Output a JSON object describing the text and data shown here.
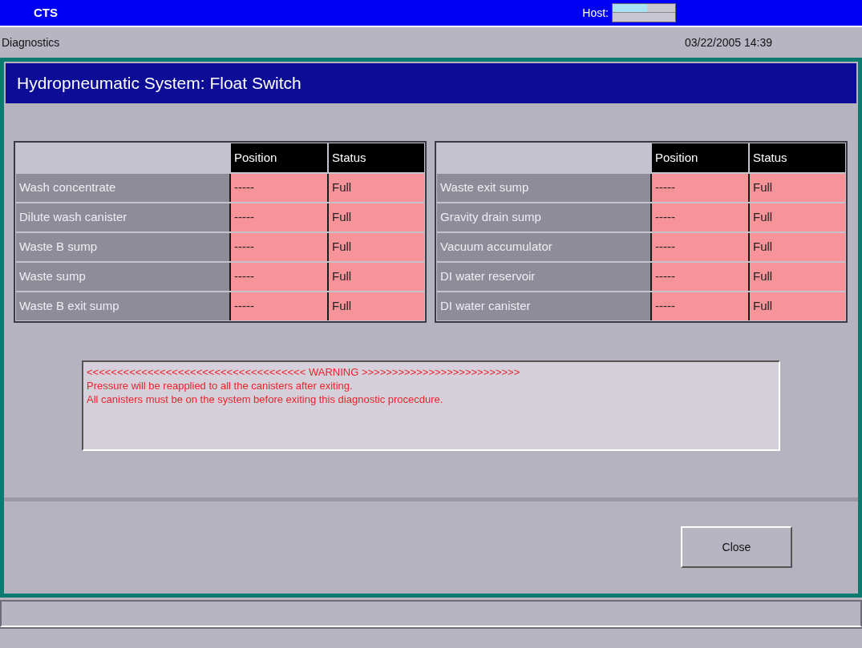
{
  "app_bar": {
    "title": "CTS",
    "host": {
      "label": "Host:",
      "level": 0.55
    }
  },
  "header": {
    "section": "Diagnostics",
    "datetime": "03/22/2005 14:39"
  },
  "panel": {
    "title": "Hydropneumatic System: Float Switch"
  },
  "tables": [
    {
      "columns": [
        "Position",
        "Status"
      ],
      "rows": [
        {
          "name": "Wash concentrate",
          "position": "-----",
          "status": "Full"
        },
        {
          "name": "Dilute wash canister",
          "position": "-----",
          "status": "Full"
        },
        {
          "name": "Waste B sump",
          "position": "-----",
          "status": "Full"
        },
        {
          "name": "Waste sump",
          "position": "-----",
          "status": "Full"
        },
        {
          "name": "Waste B exit sump",
          "position": "-----",
          "status": "Full"
        }
      ]
    },
    {
      "columns": [
        "Position",
        "Status"
      ],
      "rows": [
        {
          "name": "Waste exit sump",
          "position": "-----",
          "status": "Full"
        },
        {
          "name": "Gravity drain sump",
          "position": "-----",
          "status": "Full"
        },
        {
          "name": "Vacuum accumulator",
          "position": "-----",
          "status": "Full"
        },
        {
          "name": "DI water reservoir",
          "position": "-----",
          "status": "Full"
        },
        {
          "name": "DI water canister",
          "position": "-----",
          "status": "Full"
        }
      ]
    }
  ],
  "warning": [
    "<<<<<<<<<<<<<<<<<<<<<<<<<<<<<<<<<<<< WARNING >>>>>>>>>>>>>>>>>>>>>>>>>>",
    "Pressure will be reapplied to all the canisters after exiting.",
    "All canisters must be on the system before exiting this diagnostic procecdure."
  ],
  "buttons": [
    "Close"
  ]
}
